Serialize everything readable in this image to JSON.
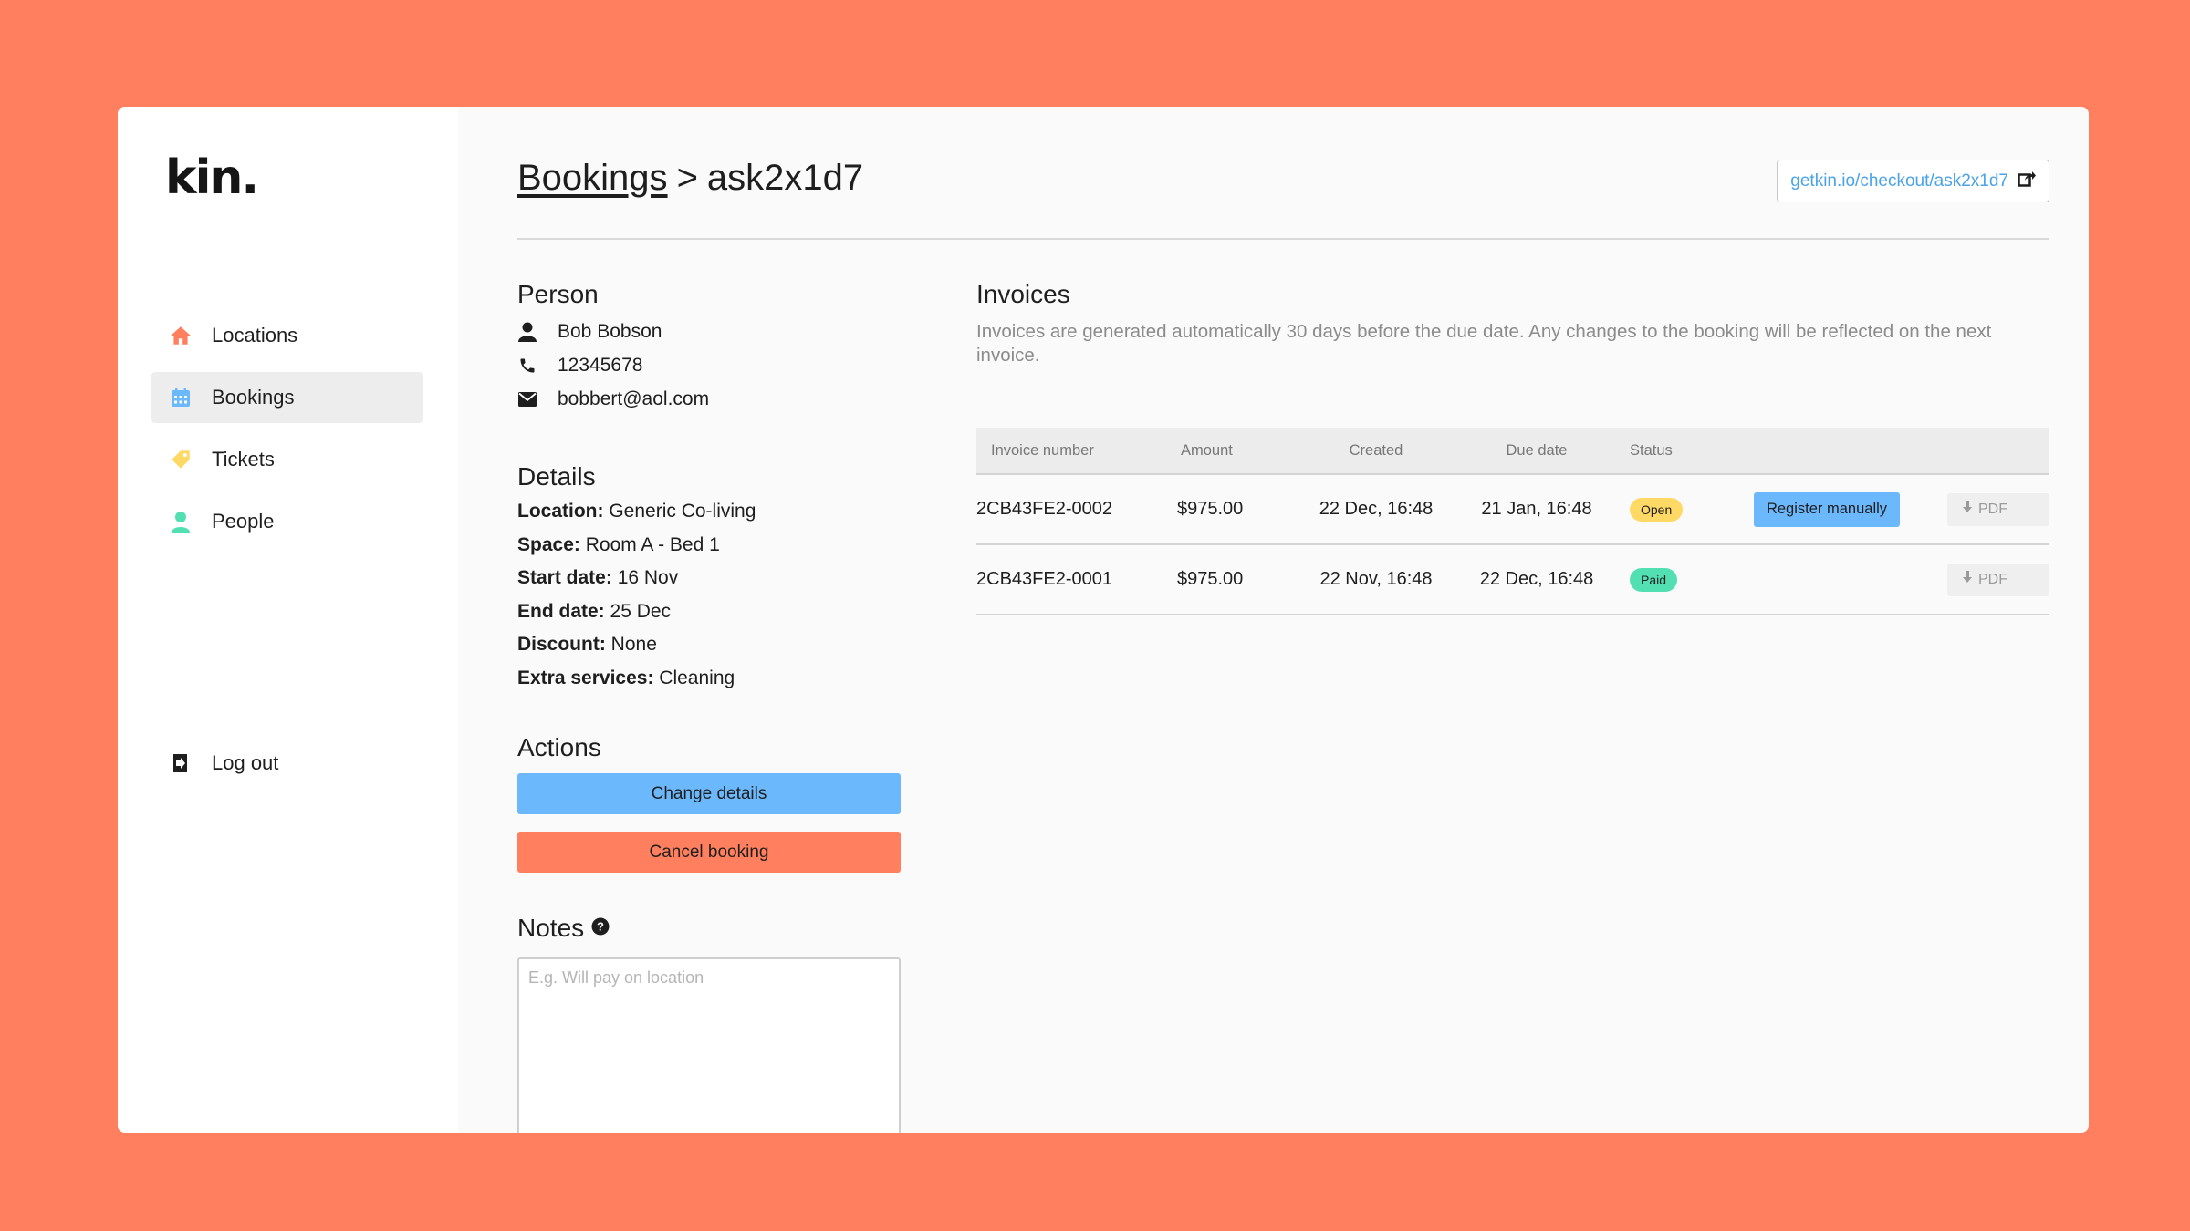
{
  "brand": {
    "logo_text": "kin."
  },
  "sidebar": {
    "items": [
      {
        "label": "Locations",
        "icon": "home-icon",
        "color": "#ff7f5e",
        "active": false
      },
      {
        "label": "Bookings",
        "icon": "calendar-icon",
        "color": "#6cb8fd",
        "active": true
      },
      {
        "label": "Tickets",
        "icon": "tag-icon",
        "color": "#ffd966",
        "active": false
      },
      {
        "label": "People",
        "icon": "person-icon",
        "color": "#52e0b2",
        "active": false
      }
    ],
    "logout_label": "Log out"
  },
  "header": {
    "breadcrumb_parent": "Bookings",
    "separator": ">",
    "booking_id": "ask2x1d7",
    "checkout_link": "getkin.io/checkout/ask2x1d7"
  },
  "person": {
    "title": "Person",
    "name": "Bob Bobson",
    "phone": "12345678",
    "email": "bobbert@aol.com"
  },
  "details": {
    "title": "Details",
    "fields": [
      {
        "label": "Location:",
        "value": "Generic Co-living"
      },
      {
        "label": "Space:",
        "value": "Room A - Bed 1"
      },
      {
        "label": "Start date:",
        "value": "16 Nov"
      },
      {
        "label": "End date:",
        "value": "25 Dec"
      },
      {
        "label": "Discount:",
        "value": "None"
      },
      {
        "label": "Extra services:",
        "value": "Cleaning"
      }
    ]
  },
  "actions": {
    "title": "Actions",
    "change_details_label": "Change details",
    "cancel_booking_label": "Cancel booking"
  },
  "notes": {
    "title": "Notes",
    "placeholder": "E.g. Will pay on location",
    "value": ""
  },
  "invoices": {
    "title": "Invoices",
    "description": "Invoices are generated automatically 30 days before the due date. Any changes to the booking will be reflected on the next invoice.",
    "columns": [
      "Invoice number",
      "Amount",
      "Created",
      "Due date",
      "Status"
    ],
    "rows": [
      {
        "number": "2CB43FE2-0002",
        "amount": "$975.00",
        "created": "22 Dec, 16:48",
        "due": "21 Jan, 16:48",
        "status": "Open",
        "action": "Register manually",
        "pdf": "PDF"
      },
      {
        "number": "2CB43FE2-0001",
        "amount": "$975.00",
        "created": "22 Nov, 16:48",
        "due": "22 Dec, 16:48",
        "status": "Paid",
        "action": "",
        "pdf": "PDF"
      }
    ]
  },
  "colors": {
    "background": "#ff7f5e",
    "accent_blue": "#6cb8fd",
    "accent_red": "#ff7f5e",
    "open_badge": "#ffd966",
    "paid_badge": "#52e0b2",
    "link": "#4aa3e8"
  }
}
